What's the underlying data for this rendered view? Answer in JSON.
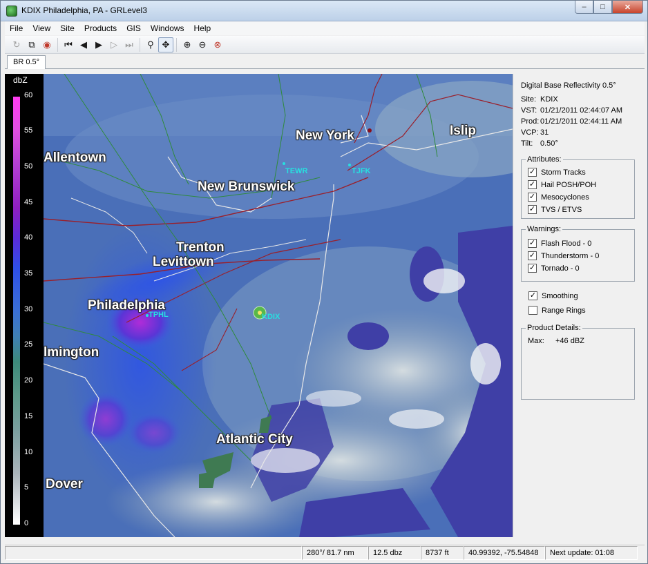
{
  "window": {
    "title": "KDIX Philadelphia, PA - GRLevel3",
    "minimize": "–",
    "maximize": "□",
    "close": "✕"
  },
  "menu": [
    "File",
    "View",
    "Site",
    "Products",
    "GIS",
    "Windows",
    "Help"
  ],
  "toolbar": {
    "icons": [
      "refresh-icon",
      "copy-icon",
      "stop-icon",
      "first-frame-icon",
      "prev-frame-icon",
      "play-icon",
      "next-frame-icon",
      "last-frame-icon",
      "zoom-icon",
      "pan-icon",
      "zoom-in-icon",
      "zoom-out-icon",
      "zoom-reset-icon"
    ]
  },
  "tab": {
    "label": "BR 0.5°"
  },
  "colorbar": {
    "unit": "dbZ",
    "labels": [
      "60",
      "55",
      "50",
      "45",
      "40",
      "35",
      "30",
      "25",
      "20",
      "15",
      "10",
      "5",
      "0"
    ]
  },
  "map": {
    "cities": [
      {
        "name": "Allentown"
      },
      {
        "name": "New York"
      },
      {
        "name": "Islip"
      },
      {
        "name": "New Brunswick"
      },
      {
        "name": "Trenton"
      },
      {
        "name": "Levittown"
      },
      {
        "name": "Philadelphia"
      },
      {
        "name": "lmington"
      },
      {
        "name": "Atlantic City"
      },
      {
        "name": "Dover"
      }
    ],
    "stations": [
      {
        "name": "TEWR"
      },
      {
        "name": "TJFK"
      },
      {
        "name": "TPHL"
      },
      {
        "name": "KDIX"
      }
    ]
  },
  "info": {
    "product": "Digital Base Reflectivity 0.5°",
    "site_label": "Site:",
    "site": "KDIX",
    "vst_label": "VST:",
    "vst": "01/21/2011  02:44:07 AM",
    "prod_label": "Prod:",
    "prod": "01/21/2011  02:44:11 AM",
    "vcp_label": "VCP:",
    "vcp": "31",
    "tilt_label": "Tilt:",
    "tilt": "0.50°"
  },
  "attributes": {
    "title": "Attributes:",
    "items": [
      {
        "label": "Storm Tracks",
        "checked": true
      },
      {
        "label": "Hail POSH/POH",
        "checked": true
      },
      {
        "label": "Mesocyclones",
        "checked": true
      },
      {
        "label": "TVS / ETVS",
        "checked": true
      }
    ]
  },
  "warnings": {
    "title": "Warnings:",
    "items": [
      {
        "label": "Flash Flood - 0",
        "checked": true
      },
      {
        "label": "Thunderstorm - 0",
        "checked": true
      },
      {
        "label": "Tornado - 0",
        "checked": true
      }
    ]
  },
  "options": [
    {
      "label": "Smoothing",
      "checked": true
    },
    {
      "label": "Range Rings",
      "checked": false
    }
  ],
  "details": {
    "title": "Product Details:",
    "max_label": "Max:",
    "max_value": "+46 dBZ"
  },
  "status": {
    "cursor": "280°/ 81.7 nm",
    "dbz": "12.5 dbz",
    "height": "8737 ft",
    "coords": "40.99392, -75.54848",
    "next": "Next update: 01:08"
  }
}
